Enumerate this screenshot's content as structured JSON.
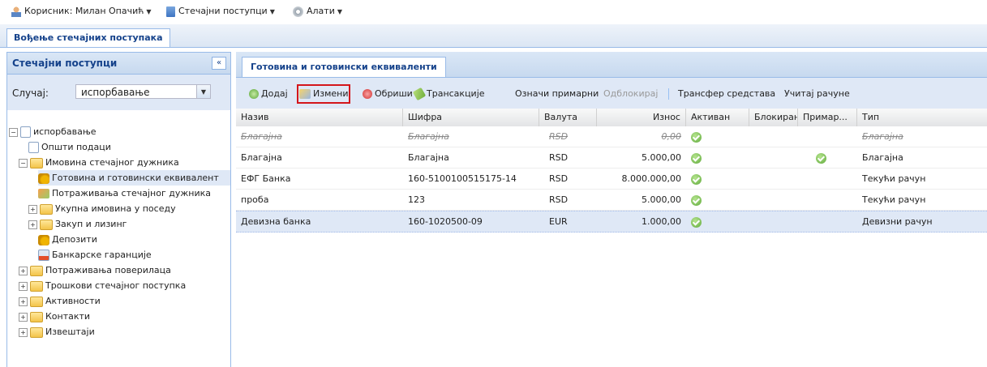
{
  "menubar": {
    "user": "Корисник: Милан Опачић",
    "procedures": "Стечајни поступци",
    "tools": "Алати"
  },
  "main_tab": "Вођење стечајних поступака",
  "left": {
    "title": "Стечајни поступци",
    "collapse": "«",
    "case_label": "Случај:",
    "case_value": "испорбавање",
    "tree": [
      {
        "label": "испорбавање"
      },
      {
        "label": "Општи подаци"
      },
      {
        "label": "Имовина стечајног дужника"
      },
      {
        "label": "Готовина и готовински еквивалент"
      },
      {
        "label": "Потраживања стечајног дужника"
      },
      {
        "label": "Укупна имовина у поседу"
      },
      {
        "label": "Закуп и лизинг"
      },
      {
        "label": "Депозити"
      },
      {
        "label": "Банкарске гаранције"
      },
      {
        "label": "Потраживања поверилаца"
      },
      {
        "label": "Трошкови стечајног поступка"
      },
      {
        "label": "Активности"
      },
      {
        "label": "Контакти"
      },
      {
        "label": "Извештаји"
      }
    ]
  },
  "right_tab": "Готовина и готовински еквиваленти",
  "toolbar": {
    "add": "Додај",
    "edit": "Измени",
    "delete": "Обриши",
    "transactions": "Трансакције",
    "mark_primary": "Означи примарни",
    "unblock": "Одблокирај",
    "transfer": "Трансфер средстава",
    "load_accounts": "Учитај рачуне"
  },
  "grid": {
    "headers": {
      "name": "Назив",
      "code": "Шифра",
      "currency": "Валута",
      "amount": "Износ",
      "active": "Активан",
      "blocked": "Блокиран",
      "primary": "Примар...",
      "type": "Тип"
    },
    "rows": [
      {
        "name": "Благајна",
        "code": "Благајна",
        "currency": "RSD",
        "amount": "0,00",
        "type": "Благајна"
      },
      {
        "name": "Благајна",
        "code": "Благајна",
        "currency": "RSD",
        "amount": "5.000,00",
        "type": "Благајна"
      },
      {
        "name": "ЕФГ Банка",
        "code": "160-5100100515175-14",
        "currency": "RSD",
        "amount": "8.000.000,00",
        "type": "Текући рачун"
      },
      {
        "name": "проба",
        "code": "123",
        "currency": "RSD",
        "amount": "5.000,00",
        "type": "Текући рачун"
      },
      {
        "name": "Девизна банка",
        "code": "160-1020500-09",
        "currency": "EUR",
        "amount": "1.000,00",
        "type": "Девизни рачун"
      }
    ]
  }
}
